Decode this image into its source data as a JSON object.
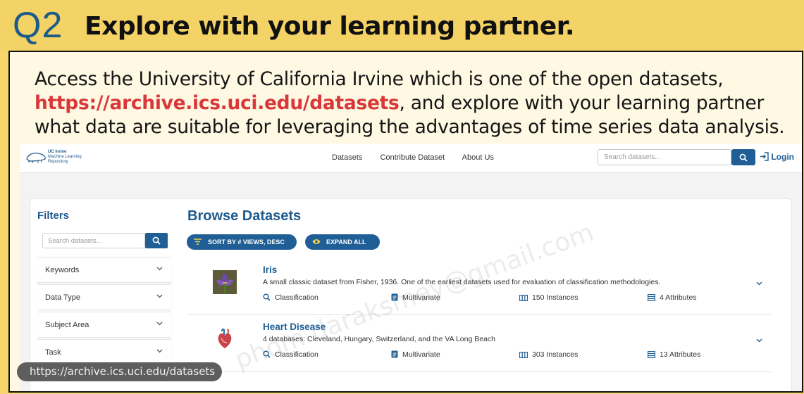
{
  "slide": {
    "question_label": "Q2",
    "title": "Explore with your learning partner.",
    "description_part1": "Access the University of California Irvine which is one of the open datasets,",
    "description_link": "https://archive.ics.uci.edu/datasets",
    "description_part2": ", and explore with your learning partner what data are suitable for leveraging the advantages of time series data analysis.",
    "colors": {
      "header_bg": "#f3d266",
      "q_label": "#1d5b8a",
      "link": "#d9383a",
      "panel_bg": "#fff8e2"
    }
  },
  "browser": {
    "logo_text": [
      "UC Irvine",
      "Machine Learning",
      "Repository"
    ],
    "nav": {
      "datasets": "Datasets",
      "contribute": "Contribute Dataset",
      "about": "About Us"
    },
    "search_placeholder": "Search datasets...",
    "login_label": "Login",
    "filters": {
      "title": "Filters",
      "search_placeholder": "Search datasets...",
      "items": [
        {
          "label": "Keywords"
        },
        {
          "label": "Data Type"
        },
        {
          "label": "Subject Area"
        },
        {
          "label": "Task"
        }
      ]
    },
    "browse": {
      "title": "Browse Datasets",
      "sort_label": "SORT BY # VIEWS, DESC",
      "expand_label": "EXPAND ALL"
    },
    "datasets": [
      {
        "name": "Iris",
        "description": "A small classic dataset from Fisher, 1936. One of the earliest datasets used for evaluation of classification methodologies.",
        "task": "Classification",
        "data_type": "Multivariate",
        "instances": "150 Instances",
        "attributes": "4 Attributes"
      },
      {
        "name": "Heart Disease",
        "description": "4 databases: Cleveland, Hungary, Switzerland, and the VA Long Beach",
        "task": "Classification",
        "data_type": "Multivariate",
        "instances": "303 Instances",
        "attributes": "13 Attributes"
      }
    ],
    "accent_color": "#1f5f96"
  },
  "watermark": "phom.daraksmey@gmail.com",
  "url_tooltip": "https://archive.ics.uci.edu/datasets"
}
